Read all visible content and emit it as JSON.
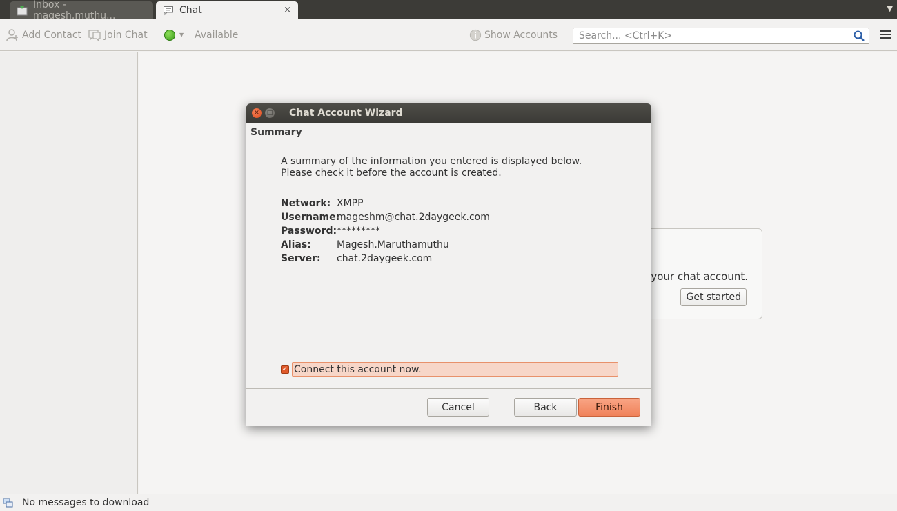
{
  "tabs": [
    {
      "label": "Inbox - magesh.muthu..."
    },
    {
      "label": "Chat",
      "close": "×"
    }
  ],
  "toolbar": {
    "add_contact": "Add Contact",
    "join_chat": "Join Chat",
    "status": "Available",
    "show_accounts": "Show Accounts",
    "search_placeholder": "Search... <Ctrl+K>"
  },
  "background_card": {
    "text": "your chat account.",
    "button": "Get started"
  },
  "statusbar": {
    "text": "No messages to download"
  },
  "dialog": {
    "title": "Chat Account Wizard",
    "section": "Summary",
    "description": "A summary of the information you entered is displayed below. Please check it before the account is created.",
    "fields": [
      {
        "label": "Network:",
        "value": "XMPP"
      },
      {
        "label": "Username:",
        "value": "mageshm@chat.2daygeek.com"
      },
      {
        "label": "Password:",
        "value": "*********"
      },
      {
        "label": "Alias:",
        "value": "Magesh.Maruthamuthu"
      },
      {
        "label": "Server:",
        "value": "chat.2daygeek.com"
      }
    ],
    "connect_label": "Connect this account now.",
    "connect_checked": true,
    "buttons": {
      "cancel": "Cancel",
      "back": "Back",
      "finish": "Finish"
    }
  },
  "colors": {
    "accent": "#f0825a",
    "status_green": "#3a9a1a",
    "titlebar": "#3c3b37"
  }
}
